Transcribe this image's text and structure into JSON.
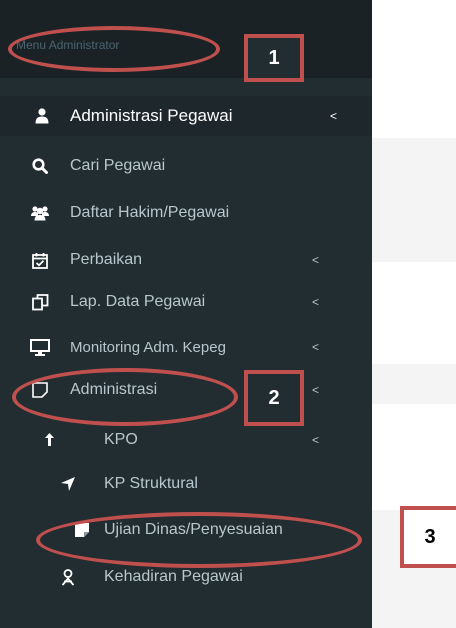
{
  "sidebar": {
    "header": "Menu Administrator",
    "section": {
      "label": "Administrasi Pegawai",
      "icon": "user-icon"
    },
    "items": [
      {
        "label": "Cari Pegawai",
        "icon": "search-icon",
        "chevron": ""
      },
      {
        "label": "Daftar Hakim/Pegawai",
        "icon": "users-icon",
        "chevron": ""
      },
      {
        "label": "Perbaikan",
        "icon": "calendar-check-icon",
        "chevron": "<"
      },
      {
        "label": "Lap. Data Pegawai",
        "icon": "copy-icon",
        "chevron": "<"
      },
      {
        "label": "Monitoring Adm. Kepeg",
        "icon": "desktop-icon",
        "chevron": "<"
      },
      {
        "label": "Administrasi",
        "icon": "square-icon",
        "chevron": "<"
      }
    ],
    "subitems": [
      {
        "label": "KPO",
        "icon": "level-up-icon",
        "chevron": "<"
      },
      {
        "label": "KP Struktural",
        "icon": "location-arrow-icon",
        "chevron": ""
      },
      {
        "label": "Ujian Dinas/Penyesuaian",
        "icon": "sticky-note-icon",
        "chevron": ""
      },
      {
        "label": "Kehadiran Pegawai",
        "icon": "person-icon",
        "chevron": ""
      }
    ],
    "section_chevron": "<"
  },
  "annotations": [
    "1",
    "2",
    "3"
  ]
}
